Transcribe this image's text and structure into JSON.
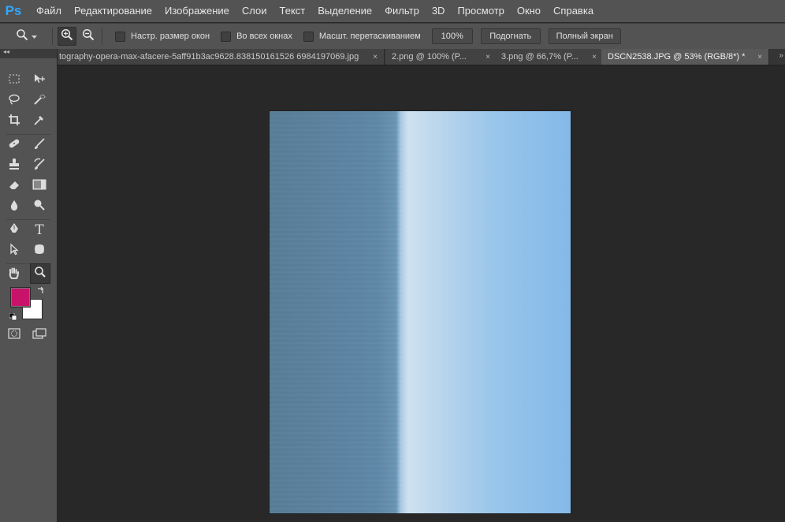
{
  "app": {
    "logo": "Ps",
    "menu": [
      "Файл",
      "Редактирование",
      "Изображение",
      "Слои",
      "Текст",
      "Выделение",
      "Фильтр",
      "3D",
      "Просмотр",
      "Окно",
      "Справка"
    ]
  },
  "options": {
    "tool_icon": "zoom-icon",
    "zoom_in_icon": "zoom-in-icon",
    "zoom_out_icon": "zoom-out-icon",
    "resize_windows_label": "Настр. размер окон",
    "all_windows_label": "Во всех окнах",
    "scrubby_zoom_label": "Масшт. перетаскиванием",
    "btn_100": "100%",
    "btn_fit": "Подогнать",
    "btn_fullscreen": "Полный экран"
  },
  "tabs": [
    {
      "title": "tography-opera-max-afacere-5aff91b3ac9628.838150161526 6984197069.jpg",
      "close": "×"
    },
    {
      "title": "2.png @ 100% (P...",
      "close": "×"
    },
    {
      "title": "3.png @ 66,7% (P...",
      "close": "×"
    },
    {
      "title": "DSCN2538.JPG @ 53% (RGB/8*) *",
      "close": "×"
    }
  ],
  "toolbar": {
    "collapse_glyph": "◂◂",
    "foreground_color": "#c8136a",
    "background_color": "#ffffff"
  }
}
